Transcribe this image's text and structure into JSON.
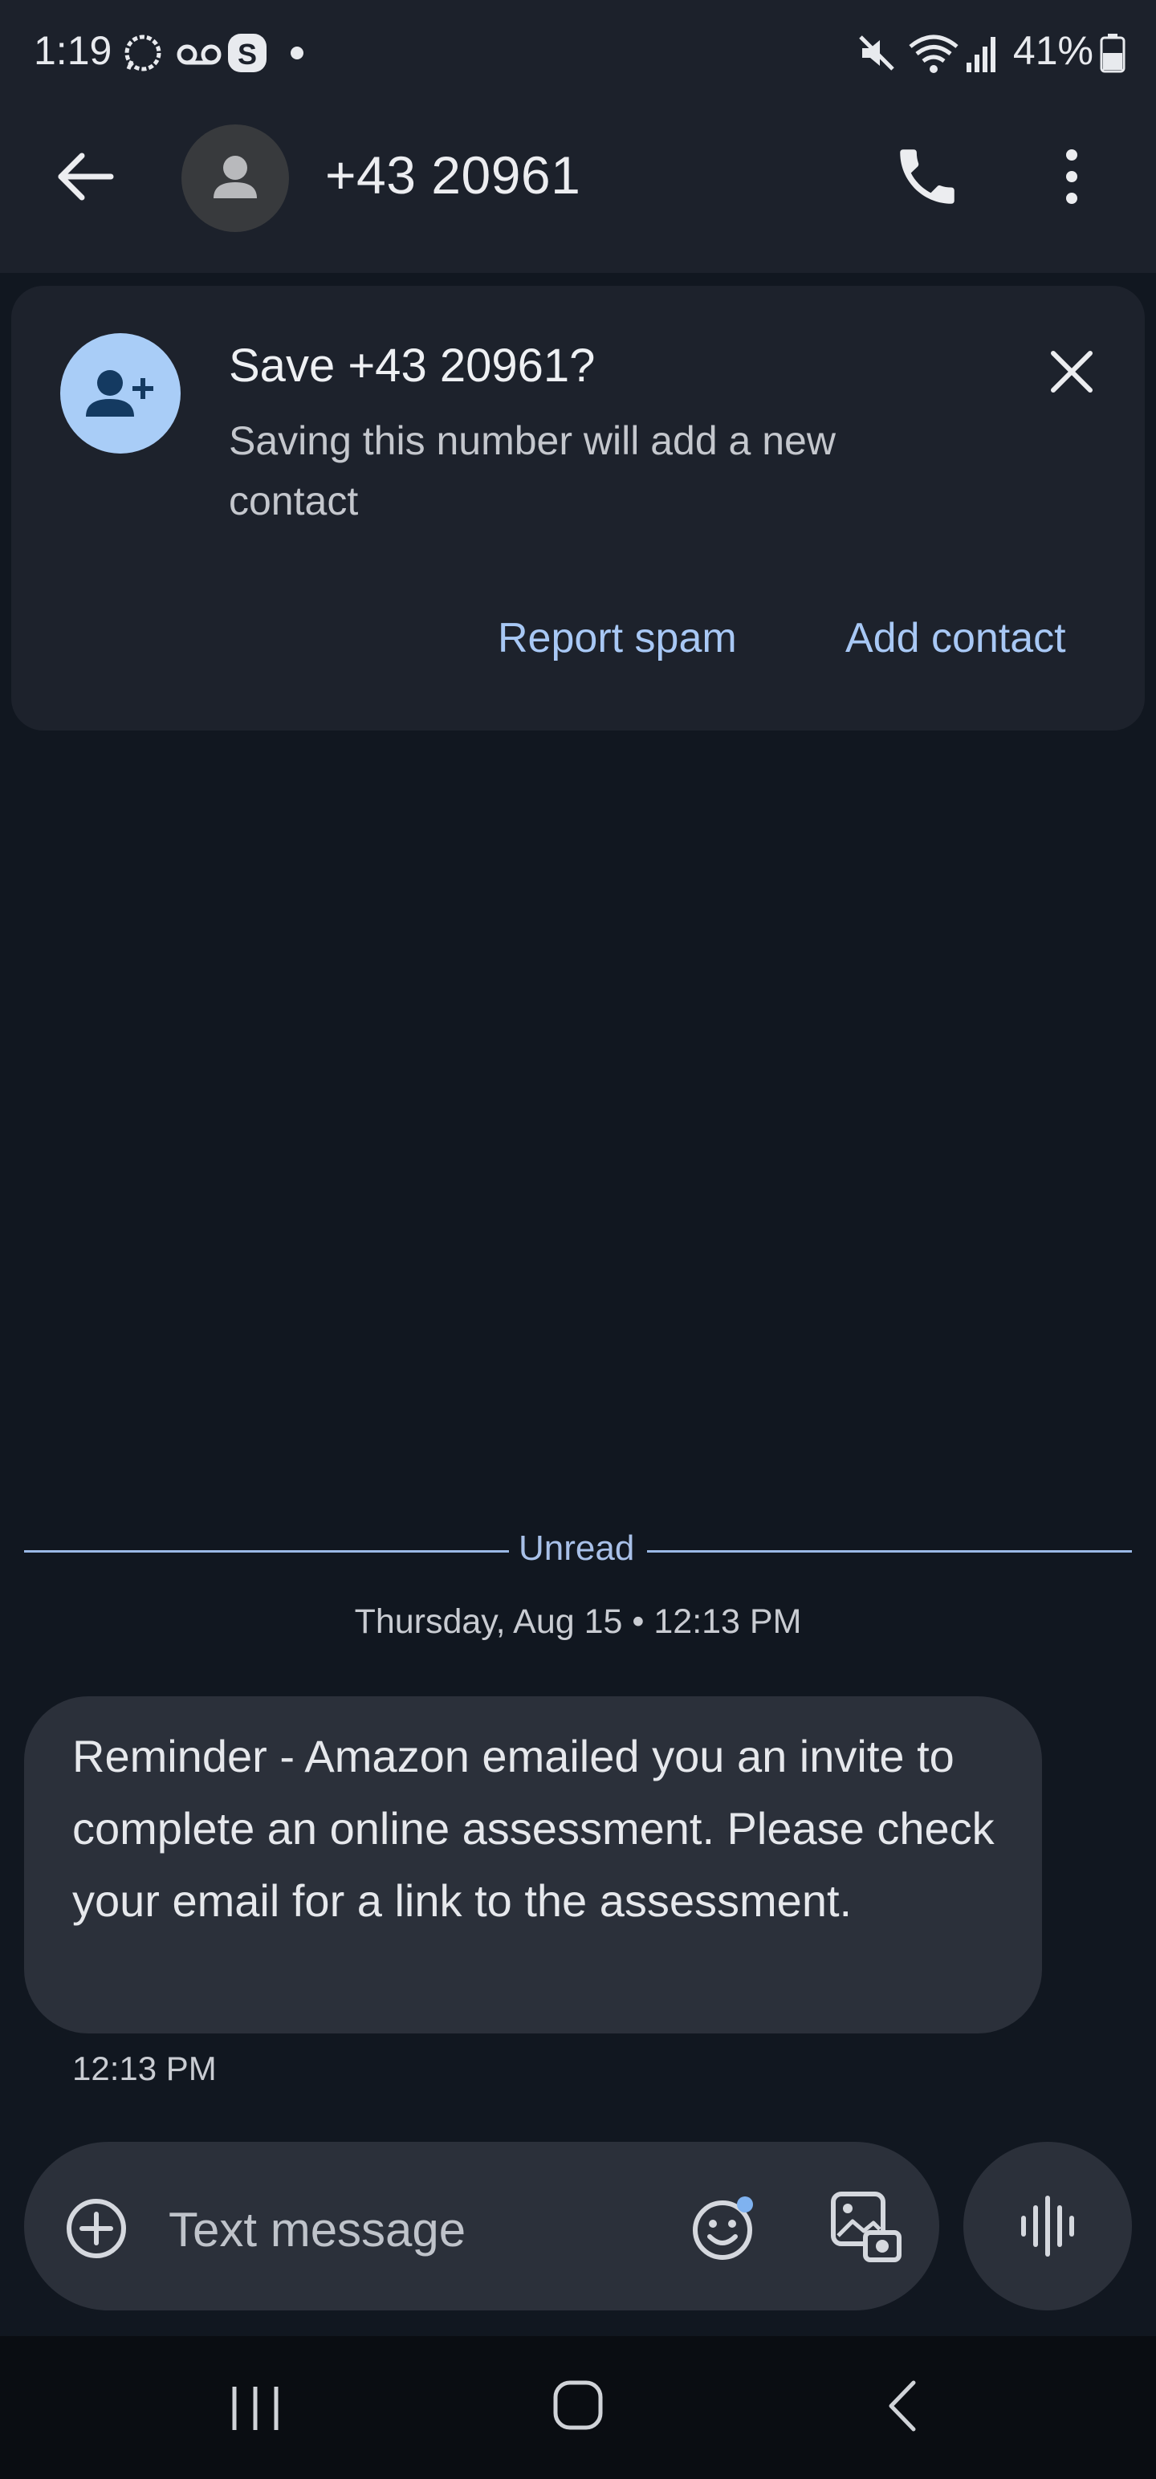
{
  "status_bar": {
    "time": "1:19",
    "battery_percent": "41%",
    "icons": [
      "signal-app-icon",
      "voicemail-icon",
      "skype-icon",
      "dot-icon",
      "mute-icon",
      "wifi-icon",
      "cell-signal-icon",
      "battery-icon"
    ]
  },
  "header": {
    "contact_number": "+43 20961",
    "icons": [
      "back-arrow-icon",
      "person-avatar-icon",
      "phone-icon",
      "more-vert-icon"
    ]
  },
  "save_card": {
    "title": "Save +43 20961?",
    "subtitle": "Saving this number will add a new contact",
    "report_spam_label": "Report spam",
    "add_contact_label": "Add contact"
  },
  "conversation": {
    "unread_label": "Unread",
    "date_label": "Thursday, Aug 15 • 12:13 PM",
    "messages": [
      {
        "text": "Reminder - Amazon emailed you an invite to complete an online assessment. Please check your email for a link to the assessment.",
        "time": "12:13 PM"
      }
    ]
  },
  "compose": {
    "placeholder": "Text message"
  },
  "colors": {
    "background": "#111720",
    "bar": "#1c212b",
    "card": "#1d222c",
    "bubble": "#2b303a",
    "accent": "#a8c8f5",
    "avatar_light_blue": "#a9cdf7"
  }
}
